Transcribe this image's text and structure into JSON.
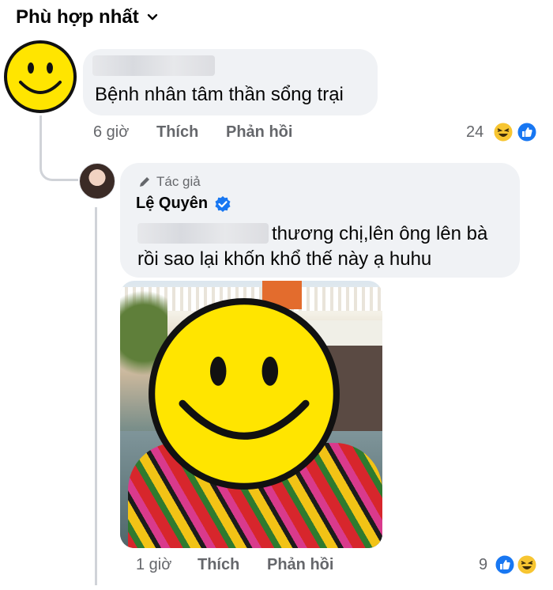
{
  "sort": {
    "label": "Phù hợp nhất"
  },
  "comment1": {
    "text": "Bệnh nhân tâm thần sổng trại",
    "time": "6 giờ",
    "like_label": "Thích",
    "reply_label": "Phản hồi",
    "reaction_count": "24"
  },
  "reply1": {
    "author_badge": "Tác giả",
    "author_name": "Lệ Quyên",
    "text_line1": "thương chị,lên ông lên bà",
    "text_line2": "rồi sao lại khốn khổ thế này ạ huhu",
    "time": "1 giờ",
    "like_label": "Thích",
    "reply_label": "Phản hồi",
    "reaction_count": "9"
  },
  "colors": {
    "bubble_bg": "#f0f2f5",
    "secondary_text": "#65676b",
    "verified_blue": "#1877f2",
    "haha_yellow": "#f7c531",
    "smiley_yellow": "#ffe500"
  },
  "icons": [
    "chevron-down-icon",
    "smiley-avatar-icon",
    "pencil-icon",
    "verified-badge-icon",
    "haha-reaction-icon",
    "like-reaction-icon"
  ]
}
